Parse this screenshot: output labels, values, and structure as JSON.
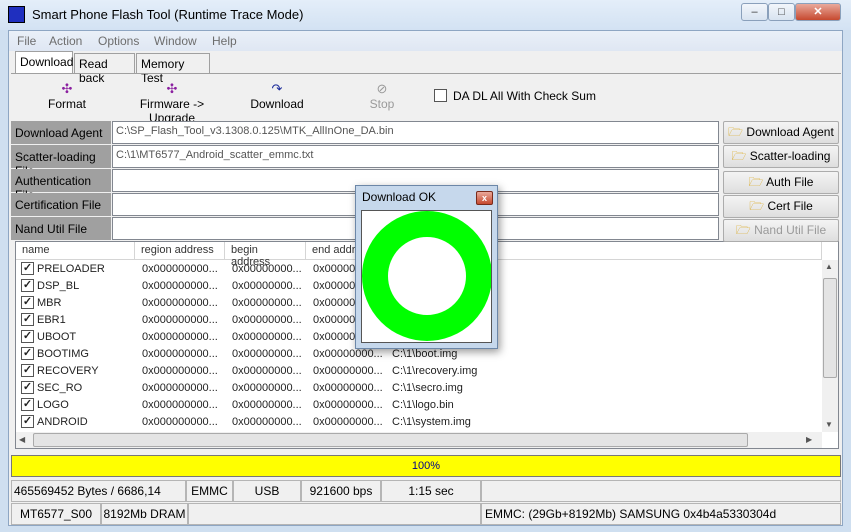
{
  "window": {
    "title": "Smart Phone Flash Tool (Runtime Trace Mode)",
    "minimize": "–",
    "maximize": "□",
    "close": "✕"
  },
  "menu": [
    "File",
    "Action",
    "Options",
    "Window",
    "Help"
  ],
  "tabs": [
    "Download",
    "Read back",
    "Memory Test"
  ],
  "toolbar": {
    "format": "Format",
    "firmware_upgrade": "Firmware -> Upgrade",
    "download": "Download",
    "stop": "Stop",
    "checksum_label": "DA DL All With Check Sum",
    "checksum_checked": false
  },
  "fields": [
    {
      "label": "Download Agent",
      "value": "C:\\SP_Flash_Tool_v3.1308.0.125\\MTK_AllInOne_DA.bin",
      "button": "Download Agent",
      "enabled": true
    },
    {
      "label": "Scatter-loading File",
      "value": "C:\\1\\MT6577_Android_scatter_emmc.txt",
      "button": "Scatter-loading",
      "enabled": true
    },
    {
      "label": "Authentication File",
      "value": "",
      "button": "Auth File",
      "enabled": true
    },
    {
      "label": "Certification File",
      "value": "",
      "button": "Cert File",
      "enabled": true
    },
    {
      "label": "Nand Util File",
      "value": "",
      "button": "Nand Util File",
      "enabled": false
    }
  ],
  "list": {
    "columns": [
      "name",
      "region address",
      "begin address",
      "end address",
      ""
    ],
    "rows": [
      {
        "name": "PRELOADER",
        "region": "0x000000000...",
        "begin": "0x00000000...",
        "end": "0x00000000...",
        "file": "77_twn_jb.bin"
      },
      {
        "name": "DSP_BL",
        "region": "0x000000000...",
        "begin": "0x00000000...",
        "end": "0x00000000...",
        "file": ""
      },
      {
        "name": "MBR",
        "region": "0x000000000...",
        "begin": "0x00000000...",
        "end": "0x00000000...",
        "file": ""
      },
      {
        "name": "EBR1",
        "region": "0x000000000...",
        "begin": "0x00000000...",
        "end": "0x00000000...",
        "file": ""
      },
      {
        "name": "UBOOT",
        "region": "0x000000000...",
        "begin": "0x00000000...",
        "end": "0x00000000...",
        "file": ""
      },
      {
        "name": "BOOTIMG",
        "region": "0x000000000...",
        "begin": "0x00000000...",
        "end": "0x00000000...",
        "file": "C:\\1\\boot.img"
      },
      {
        "name": "RECOVERY",
        "region": "0x000000000...",
        "begin": "0x00000000...",
        "end": "0x00000000...",
        "file": "C:\\1\\recovery.img"
      },
      {
        "name": "SEC_RO",
        "region": "0x000000000...",
        "begin": "0x00000000...",
        "end": "0x00000000...",
        "file": "C:\\1\\secro.img"
      },
      {
        "name": "LOGO",
        "region": "0x000000000...",
        "begin": "0x00000000...",
        "end": "0x00000000...",
        "file": "C:\\1\\logo.bin"
      },
      {
        "name": "ANDROID",
        "region": "0x000000000...",
        "begin": "0x00000000...",
        "end": "0x00000000...",
        "file": "C:\\1\\system.img"
      }
    ]
  },
  "progress": {
    "text": "100%",
    "value": 100,
    "color": "#ffff00"
  },
  "status1": [
    "465569452 Bytes / 6686,14 KBps",
    "EMMC",
    "USB",
    "921600 bps",
    "1:15 sec",
    ""
  ],
  "status2": [
    "MT6577_S00",
    "8192Mb DRAM",
    "",
    "EMMC: (29Gb+8192Mb) SAMSUNG 0x4b4a5330304d"
  ],
  "dialog": {
    "title": "Download OK",
    "close": "x",
    "ring_color": "#00ff00"
  }
}
